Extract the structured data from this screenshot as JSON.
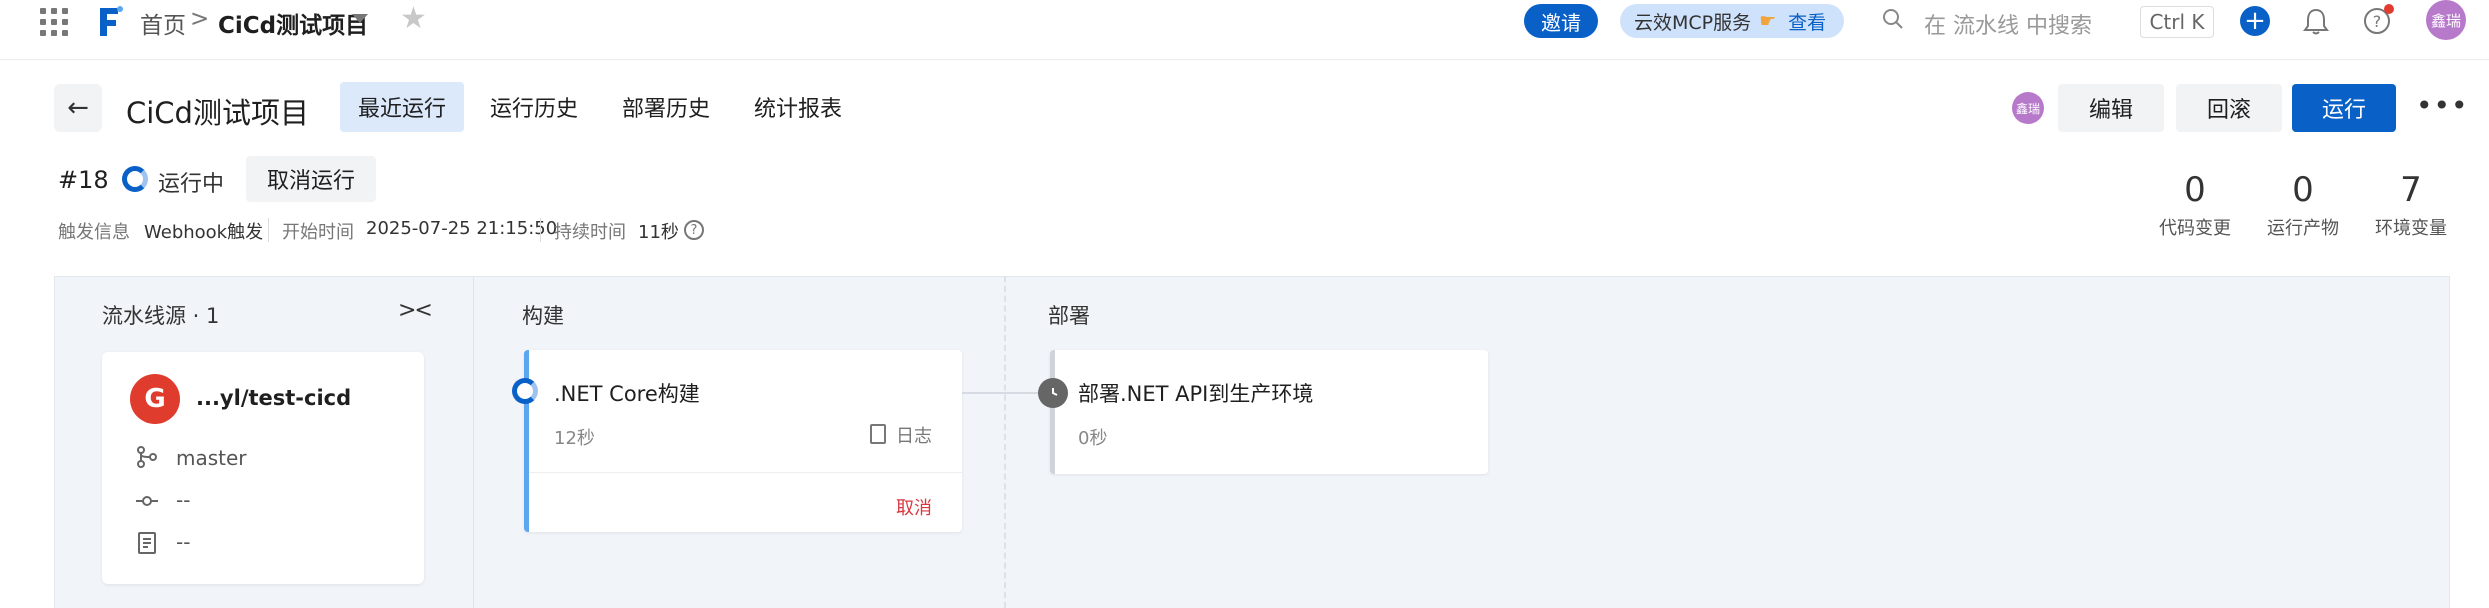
{
  "topbar": {
    "breadcrumb_home": "首页",
    "breadcrumb_sep": ">",
    "breadcrumb_project": "CiCd测试项目",
    "invite_label": "邀请",
    "mcp_label": "云效MCP服务",
    "mcp_view": "查看",
    "search_placeholder": "在 流水线 中搜索",
    "shortcut": "Ctrl K",
    "plus": "+",
    "avatar": "鑫瑞"
  },
  "header": {
    "back": "←",
    "title": "CiCd测试项目",
    "tabs": [
      {
        "label": "最近运行",
        "active": true
      },
      {
        "label": "运行历史",
        "active": false
      },
      {
        "label": "部署历史",
        "active": false
      },
      {
        "label": "统计报表",
        "active": false
      }
    ],
    "avatar": "鑫瑞",
    "edit_label": "编辑",
    "rollback_label": "回滚",
    "run_label": "运行",
    "more": "•••"
  },
  "run": {
    "number": "#18",
    "status": "运行中",
    "cancel_label": "取消运行",
    "trigger_key": "触发信息",
    "trigger_val": "Webhook触发",
    "start_key": "开始时间",
    "start_val": "2025-07-25 21:15:50",
    "duration_key": "持续时间",
    "duration_val": "11秒",
    "help": "?"
  },
  "stats": [
    {
      "value": "0",
      "label": "代码变更"
    },
    {
      "value": "0",
      "label": "运行产物"
    },
    {
      "value": "7",
      "label": "环境变量"
    }
  ],
  "pipeline": {
    "source_title": "流水线源 · 1",
    "collapse": "><",
    "source": {
      "logo": "G",
      "repo": "...yl/test-cicd",
      "branch": "master",
      "commit": "--",
      "message": "--"
    },
    "build_stage": "构建",
    "deploy_stage": "部署",
    "build_job": {
      "name": ".NET Core构建",
      "time": "12秒",
      "log_label": "日志",
      "cancel_label": "取消"
    },
    "deploy_job": {
      "name": "部署.NET API到生产环境",
      "time": "0秒"
    }
  },
  "colors": {
    "brand": "#0960c7",
    "active_tab": "#dbe9fb",
    "avatar": "#b77acb",
    "gitee": "#e03c2e",
    "cancel": "#d9363e"
  }
}
